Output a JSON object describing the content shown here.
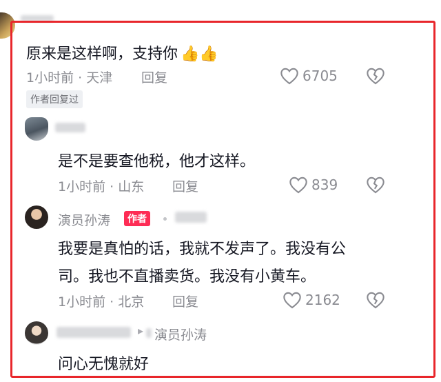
{
  "comments": [
    {
      "text": "原来是这样啊，支持你",
      "emoji": "👍👍",
      "time": "1小时前 · 天津",
      "reply": "回复",
      "likes": "6705",
      "badge": "作者回复过"
    },
    {
      "text": "是不是要查他税，他才这样。",
      "time": "1小时前 · 山东",
      "reply": "回复",
      "likes": "839"
    },
    {
      "username": "演员孙涛",
      "author_tag": "作者",
      "line1": "我要是真怕的话，我就不发声了。我没有公",
      "line2": "司。我也不直播卖货。我没有小黄车。",
      "time": "1小时前 · 北京",
      "reply": "回复",
      "likes": "2162"
    },
    {
      "arrow": "▸",
      "reply_to": "演员孙涛",
      "text": "问心无愧就好"
    }
  ]
}
